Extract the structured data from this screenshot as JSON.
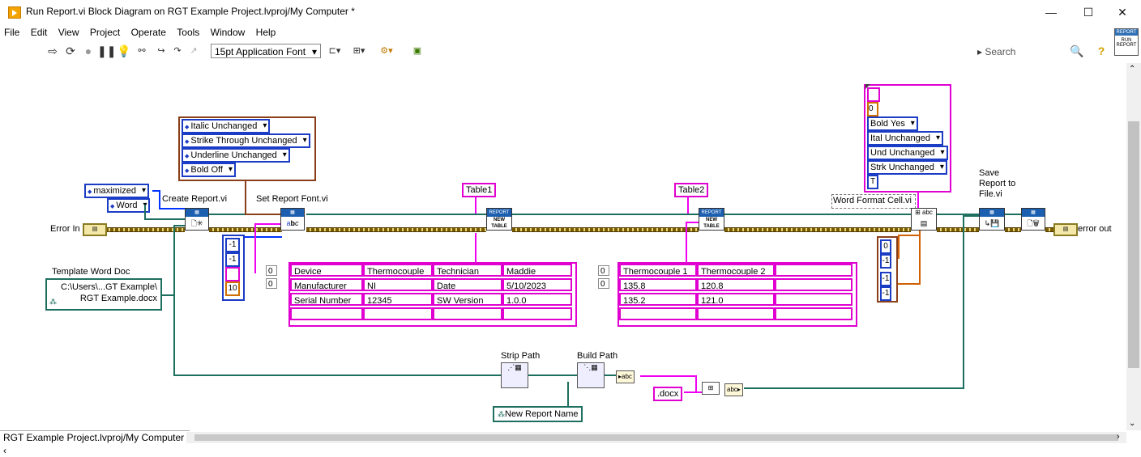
{
  "window": {
    "title": "Run Report.vi Block Diagram on RGT Example Project.lvproj/My Computer *",
    "minimize": "—",
    "maximize": "☐",
    "close": "✕"
  },
  "menu": [
    "File",
    "Edit",
    "View",
    "Project",
    "Operate",
    "Tools",
    "Window",
    "Help"
  ],
  "toolbar": {
    "font": "15pt Application Font",
    "search_placeholder": "Search",
    "report_icon_top": "REPORT",
    "report_icon_bottom": "RUN REPORT",
    "help_icon": "?"
  },
  "diagram": {
    "error_in": "Error In",
    "error_out": "error out",
    "window_state": "maximized",
    "report_type": "Word",
    "create_report": "Create Report.vi",
    "set_report_font": "Set Report Font.vi",
    "template_label": "Template Word Doc",
    "template_path_1": "C:\\Users\\...GT Example\\",
    "template_path_2": "RGT Example.docx",
    "font_enums": [
      "Italic Unchanged",
      "Strike Through Unchanged",
      "Underline Unchanged",
      "Bold Off"
    ],
    "font_numbers": [
      "-1",
      "-1",
      "",
      "10"
    ],
    "table1_label": "Table1",
    "table2_label": "Table2",
    "new_table": "NEW TABLE",
    "report_hdr": "REPORT",
    "table1_index": [
      "0",
      "0"
    ],
    "table1_rows": [
      [
        "Device",
        "Thermocouple",
        "Technician",
        "Maddie"
      ],
      [
        "Manufacturer",
        "NI",
        "Date",
        "5/10/2023"
      ],
      [
        "Serial Number",
        "12345",
        "SW Version",
        "1.0.0"
      ]
    ],
    "table2_index": [
      "0",
      "0"
    ],
    "table2_rows": [
      [
        "Thermocouple 1",
        "Thermocouple 2"
      ],
      [
        "135.8",
        "120.8"
      ],
      [
        "135.2",
        "121.0"
      ]
    ],
    "cell_format_top_value": "0",
    "cell_format_enums": [
      "Bold Yes",
      "Ital Unchanged",
      "Und Unchanged",
      "Strk Unchanged"
    ],
    "cell_format_bool": "T",
    "word_format_cell": "Word Format Cell.vi",
    "cell_numbers": [
      "0",
      "-1",
      "-1",
      "-1"
    ],
    "save_report": "Save Report to File.vi",
    "strip_path": "Strip Path",
    "build_path": "Build Path",
    "docx": ".docx",
    "new_report_name": "New Report Name"
  },
  "status": {
    "context": "RGT Example Project.lvproj/My Computer"
  }
}
